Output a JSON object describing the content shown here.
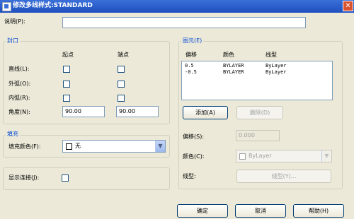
{
  "window": {
    "title": "修改多线样式:STANDARD",
    "close_glyph": "✕"
  },
  "description": {
    "label": "说明(P):",
    "value": ""
  },
  "caps": {
    "group_title": "封口",
    "start_header": "起点",
    "end_header": "端点",
    "rows": [
      {
        "label": "直线(L):",
        "start_checked": false,
        "end_checked": false
      },
      {
        "label": "外弧(O):",
        "start_checked": false,
        "end_checked": false
      },
      {
        "label": "内弧(R):",
        "start_checked": false,
        "end_checked": false
      }
    ],
    "angle_label": "角度(N):",
    "angle_start": "90.00",
    "angle_end": "90.00"
  },
  "fill": {
    "group_title": "填充",
    "color_label": "填充颜色(F):",
    "color_value": "无"
  },
  "joints": {
    "label": "显示连接(J):",
    "checked": false
  },
  "elements": {
    "group_title": "图元(E)",
    "columns": [
      "偏移",
      "颜色",
      "线型"
    ],
    "rows": [
      {
        "offset": "0.5",
        "color": "BYLAYER",
        "linetype": "ByLayer"
      },
      {
        "offset": "-0.5",
        "color": "BYLAYER",
        "linetype": "ByLayer"
      }
    ],
    "add_label": "添加(A)",
    "delete_label": "删除(D)",
    "offset_label": "偏移(S):",
    "offset_value": "0.000",
    "color_label": "颜色(C):",
    "color_value": "ByLayer",
    "linetype_label": "线型:",
    "linetype_button": "线型(Y)..."
  },
  "buttons": {
    "ok": "确定",
    "cancel": "取消",
    "help": "帮助(H)"
  }
}
